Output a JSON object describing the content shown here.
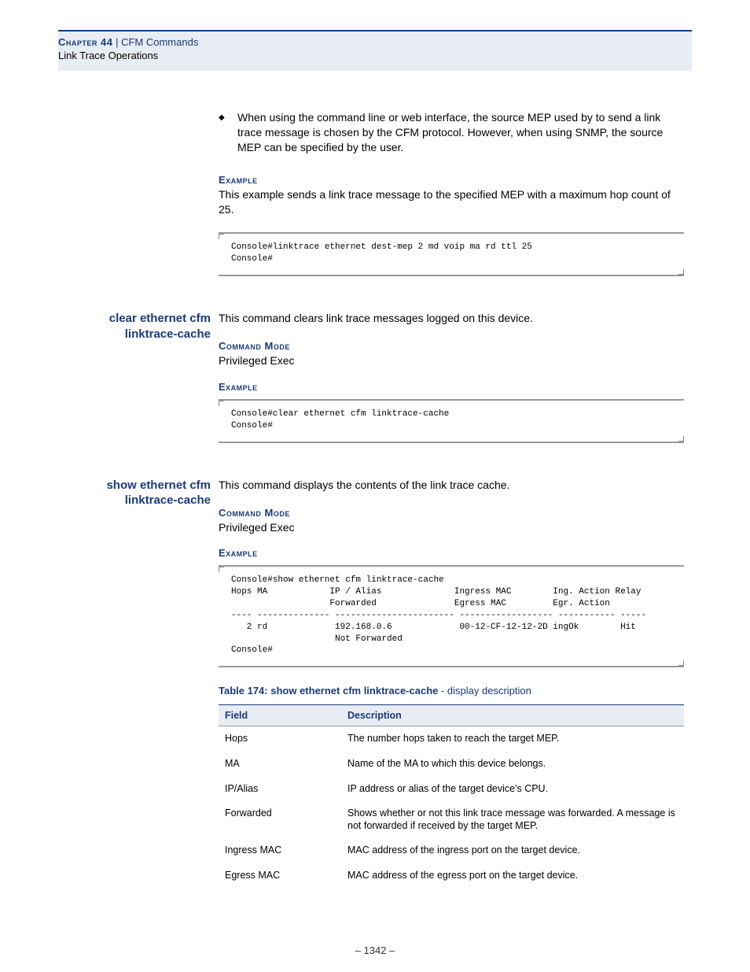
{
  "header": {
    "chapter_label": "Chapter 44",
    "separator": "  |  ",
    "chapter_title": "CFM Commands",
    "subtitle": "Link Trace Operations"
  },
  "bullet1": "When using the command line or web interface, the source MEP used by to send a link trace message is chosen by the CFM protocol. However, when using SNMP, the source MEP can be specified by the user.",
  "labels": {
    "example": "Example",
    "command_mode": "Command Mode"
  },
  "example1_intro": "This example sends a link trace message to the specified MEP with a maximum hop count of 25.",
  "code1": "Console#linktrace ethernet dest-mep 2 md voip ma rd ttl 25\nConsole#",
  "cmd1": {
    "name": "clear ethernet cfm linktrace-cache",
    "desc": "This command clears link trace messages logged on this device.",
    "mode": "Privileged Exec"
  },
  "code2": "Console#clear ethernet cfm linktrace-cache\nConsole#",
  "cmd2": {
    "name": "show ethernet cfm linktrace-cache",
    "desc": "This command displays the contents of the link trace cache.",
    "mode": "Privileged Exec"
  },
  "code3": "Console#show ethernet cfm linktrace-cache\nHops MA            IP / Alias              Ingress MAC        Ing. Action Relay\n                   Forwarded               Egress MAC         Egr. Action\n---- -------------- ----------------------- ------------------ ----------- -----\n   2 rd             192.168.0.6             00-12-CF-12-12-2D ingOk        Hit\n                    Not Forwarded\nConsole#",
  "table": {
    "caption_bold": "Table 174: show ethernet cfm linktrace-cache",
    "caption_rest": " - display description",
    "head_field": "Field",
    "head_desc": "Description",
    "rows": [
      {
        "f": "Hops",
        "d": "The number hops taken to reach the target MEP."
      },
      {
        "f": "MA",
        "d": "Name of the MA to which this device belongs."
      },
      {
        "f": "IP/Alias",
        "d": "IP address or alias of the target device's CPU."
      },
      {
        "f": "Forwarded",
        "d": "Shows whether or not this link trace message was forwarded. A message is not forwarded if received by the target MEP."
      },
      {
        "f": "Ingress MAC",
        "d": "MAC address of the ingress port on the target device."
      },
      {
        "f": "Egress MAC",
        "d": "MAC address of the egress port on the target device."
      }
    ]
  },
  "page_number": "–  1342  –"
}
